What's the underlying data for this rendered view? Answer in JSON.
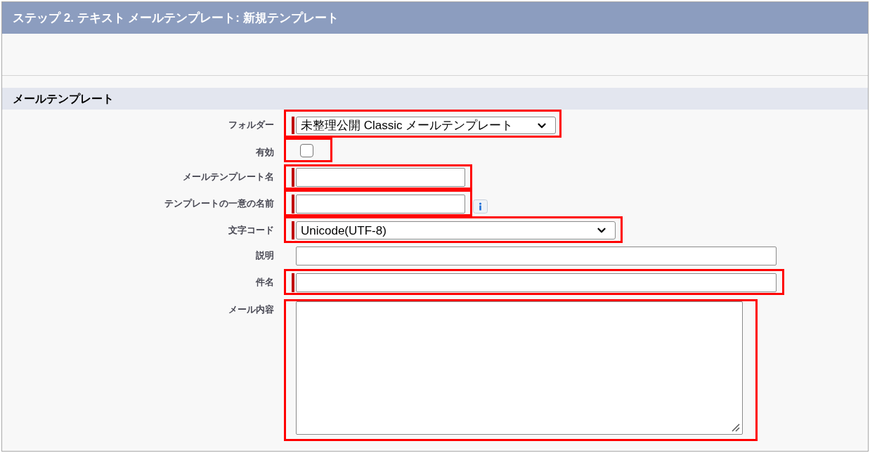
{
  "header": {
    "title": "ステップ 2. テキスト メールテンプレート: 新規テンプレート"
  },
  "section": {
    "title": "メールテンプレート"
  },
  "fields": [
    {
      "label": "フォルダー",
      "kind": "select",
      "value": "未整理公開 Classic メールテンプレート",
      "required": true,
      "highlighted": true,
      "info": false
    },
    {
      "label": "有効",
      "kind": "checkbox",
      "checked": false,
      "required": false,
      "highlighted": true,
      "info": false
    },
    {
      "label": "メールテンプレート名",
      "kind": "text",
      "required": true,
      "highlighted": true,
      "info": false
    },
    {
      "label": "テンプレートの一意の名前",
      "kind": "text",
      "required": true,
      "highlighted": true,
      "info": true
    },
    {
      "label": "文字コード",
      "kind": "select",
      "value": "Unicode(UTF-8)",
      "required": true,
      "highlighted": true,
      "info": false
    },
    {
      "label": "説明",
      "kind": "text",
      "required": false,
      "highlighted": false,
      "info": false
    },
    {
      "label": "件名",
      "kind": "text",
      "required": true,
      "highlighted": true,
      "info": false
    },
    {
      "label": "メール内容",
      "kind": "textarea",
      "required": false,
      "highlighted": true,
      "info": false
    }
  ]
}
